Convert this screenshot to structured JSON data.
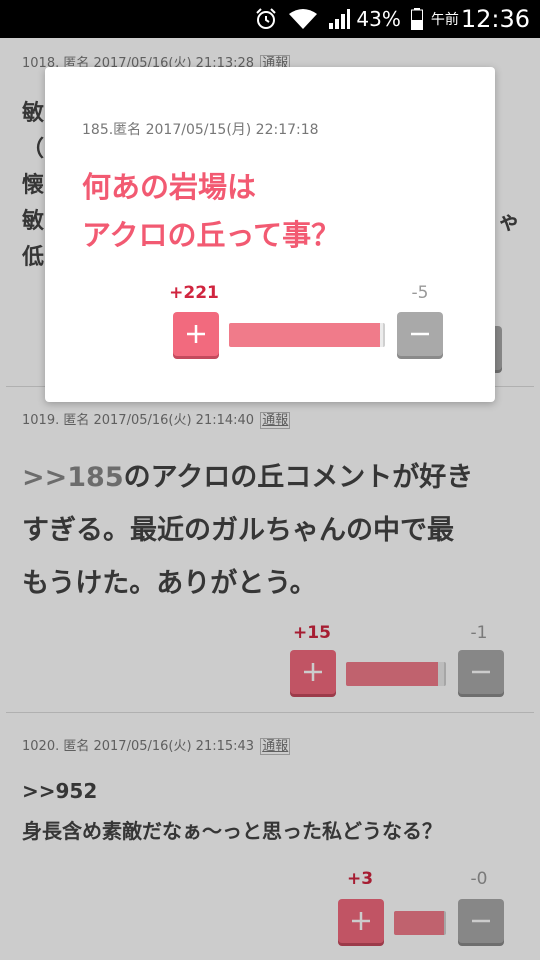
{
  "status_bar": {
    "battery_percent": "43%",
    "ampm": "午前",
    "time": "12:36"
  },
  "comments": [
    {
      "meta": "1018. 匿名 2017/05/16(火) 21:13:28",
      "report": "通報",
      "visible_lines": [
        "敏",
        "（",
        "懐",
        "敏",
        "低"
      ],
      "visible_line_end": "ゃ"
    },
    {
      "meta": "1019. 匿名 2017/05/16(火) 21:14:40",
      "report": "通報",
      "anchor": ">>185",
      "text_line1": "のアクロの丘コメントが好き",
      "text_line2": "すぎる。最近のガルちゃんの中で最",
      "text_line3": "もうけた。ありがとう。",
      "plus": "+15",
      "minus": "-1",
      "plus_ratio": 0.94
    },
    {
      "meta": "1020. 匿名 2017/05/16(火) 21:15:43",
      "report": "通報",
      "anchor": ">>952",
      "text": "身長含め素敵だなぁ〜っと思った私どうなる？",
      "plus": "+3",
      "minus": "-0",
      "plus_ratio": 1.0
    }
  ],
  "popup": {
    "meta": "185.匿名 2017/05/15(月) 22:17:18",
    "text_line1": "何あの岩場は",
    "text_line2": "アクロの丘って事？",
    "plus": "+221",
    "minus": "-5",
    "plus_ratio": 0.98
  },
  "colors": {
    "plus": "#f26a7e",
    "minus": "#a9a9a9",
    "popup_text": "#f25a72"
  }
}
